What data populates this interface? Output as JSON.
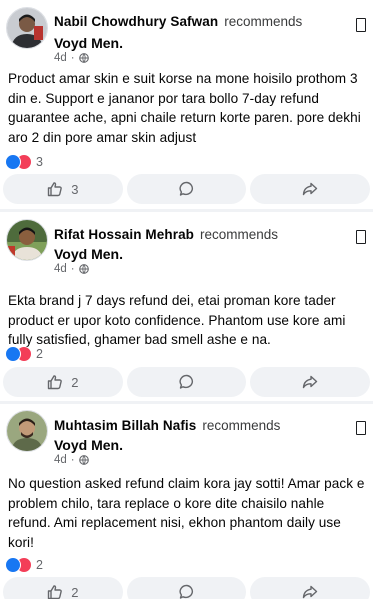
{
  "posts": [
    {
      "author": "Nabil Chowdhury Safwan",
      "action": "recommends",
      "page": "Voyd Men.",
      "time": "4d",
      "privacy_icon": "globe-icon",
      "text": "Product amar skin e suit korse na mone hoisilo prothom 3 din e. Support e jananor por tara bollo 7-day refund guarantee ache, apni chaile return korte paren. pore dekhi aro 2 din pore amar skin adjust",
      "reaction_count": "3",
      "like_count": "3"
    },
    {
      "author": "Rifat Hossain Mehrab",
      "action": "recommends",
      "page": "Voyd Men.",
      "time": "4d",
      "privacy_icon": "globe-icon",
      "text": "Ekta brand j 7 days refund dei, etai proman kore tader product er upor koto confidence. Phantom use kore ami fully satisfied, ghamer bad smell ashe e na.",
      "reaction_count": "2",
      "like_count": "2"
    },
    {
      "author": "Muhtasim Billah Nafis",
      "action": "recommends",
      "page": "Voyd Men.",
      "time": "4d",
      "privacy_icon": "globe-icon",
      "text": "No question asked refund claim kora jay sotti! Amar pack e problem chilo, tara replace o kore dite chaisilo nahle refund. Ami replacement nisi, ekhon phantom daily use kori!",
      "reaction_count": "2",
      "like_count": "2"
    }
  ],
  "colors": {
    "like_blue": "#1877f2",
    "love_red": "#f33e58",
    "secondary_text": "#65676b",
    "feed_bg": "#f0f2f5"
  }
}
